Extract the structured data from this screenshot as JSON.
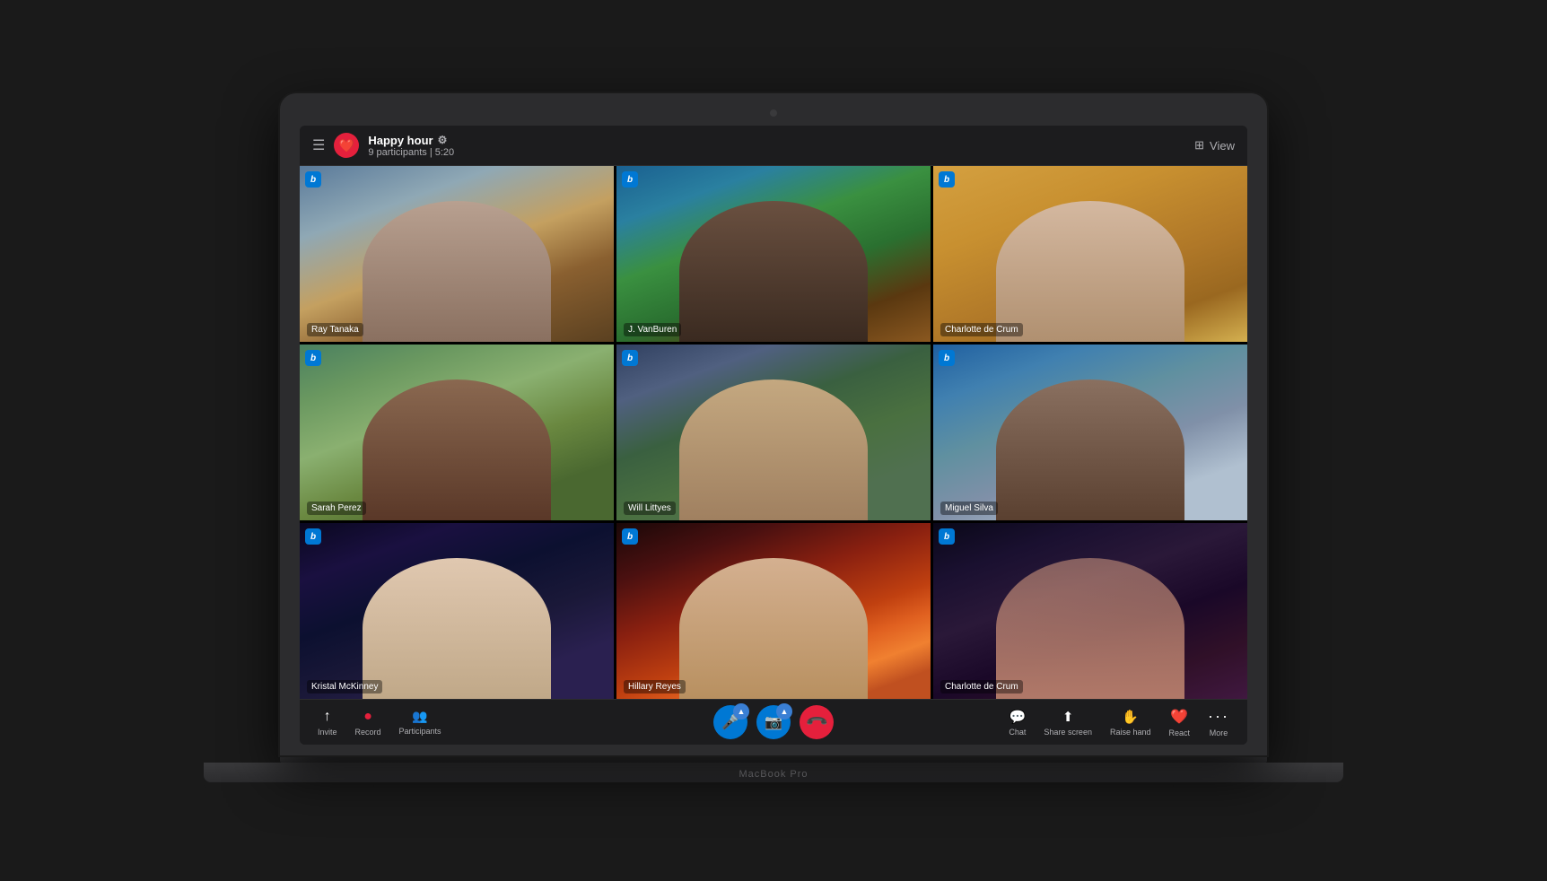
{
  "app": {
    "laptop_label": "MacBook Pro"
  },
  "header": {
    "menu_icon": "☰",
    "meeting_emoji": "❤️",
    "meeting_title": "Happy hour",
    "meeting_gear": "⚙",
    "meeting_subtitle": "9 participants | 5:20",
    "view_icon": "⊞",
    "view_label": "View"
  },
  "participants": [
    {
      "name": "Ray Tanaka",
      "bg": "mountains",
      "badge": "b"
    },
    {
      "name": "J. VanBuren",
      "bg": "beach",
      "badge": "b"
    },
    {
      "name": "Charlotte de Crum",
      "bg": "desert",
      "badge": "b"
    },
    {
      "name": "Sarah Perez",
      "bg": "birds",
      "badge": "b"
    },
    {
      "name": "Will Littyes",
      "bg": "valley",
      "badge": "b"
    },
    {
      "name": "Miguel Silva",
      "bg": "water",
      "badge": "b"
    },
    {
      "name": "Kristal McKinney",
      "bg": "galaxy",
      "badge": "b"
    },
    {
      "name": "Hillary Reyes",
      "bg": "sunset",
      "badge": "b"
    },
    {
      "name": "Charlotte de Crum",
      "bg": "dusk",
      "badge": "b"
    }
  ],
  "toolbar": {
    "left": [
      {
        "id": "invite",
        "icon": "⬆",
        "label": "Invite"
      },
      {
        "id": "record",
        "icon": "⏺",
        "label": "Record"
      },
      {
        "id": "participants",
        "icon": "👥",
        "label": "Participants"
      }
    ],
    "center": [
      {
        "id": "mic",
        "icon": "🎤",
        "color": "blue",
        "has_chevron": true
      },
      {
        "id": "camera",
        "icon": "📷",
        "color": "blue",
        "has_chevron": true
      },
      {
        "id": "hangup",
        "icon": "📞",
        "color": "red"
      }
    ],
    "right": [
      {
        "id": "chat",
        "icon": "💬",
        "label": "Chat"
      },
      {
        "id": "share-screen",
        "icon": "⬆",
        "label": "Share screen"
      },
      {
        "id": "raise-hand",
        "icon": "✋",
        "label": "Raise hand"
      },
      {
        "id": "react",
        "icon": "❤️",
        "label": "React"
      },
      {
        "id": "more",
        "icon": "•••",
        "label": "More"
      }
    ]
  }
}
